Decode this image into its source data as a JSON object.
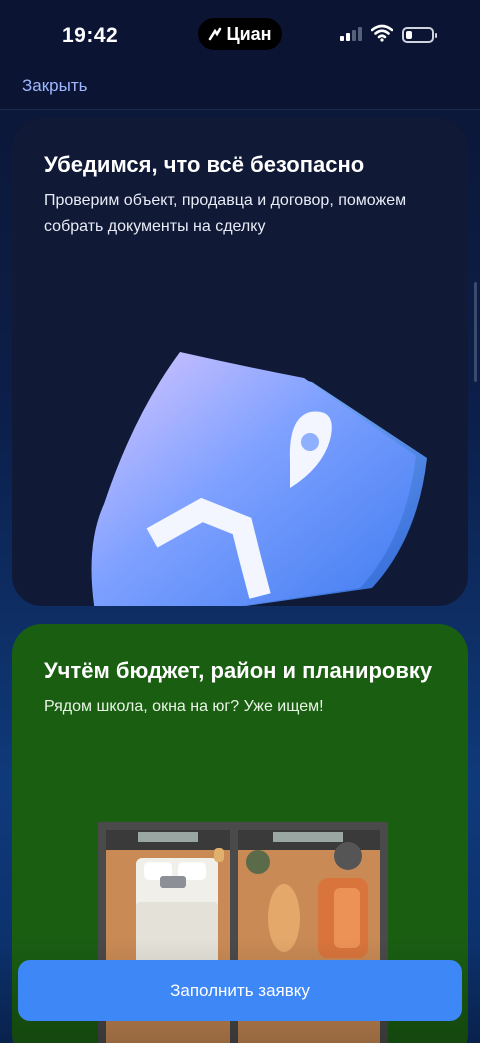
{
  "status_bar": {
    "time": "19:42",
    "app_pill": "Циан"
  },
  "header": {
    "close_label": "Закрыть"
  },
  "cards": [
    {
      "title": "Убедимся, что всё безопасно",
      "text": "Проверим объект, продавца и договор, поможем собрать документы на сделку",
      "image_icon": "shield-icon",
      "background": "#101935"
    },
    {
      "title": "Учтём бюджет, район и планировку",
      "text": "Рядом школа, окна на юг? Уже ищем!",
      "image_icon": "floor-plan-icon",
      "background": "#1a5e12"
    }
  ],
  "cta": {
    "label": "Заполнить заявку",
    "color": "#3d87f7"
  }
}
